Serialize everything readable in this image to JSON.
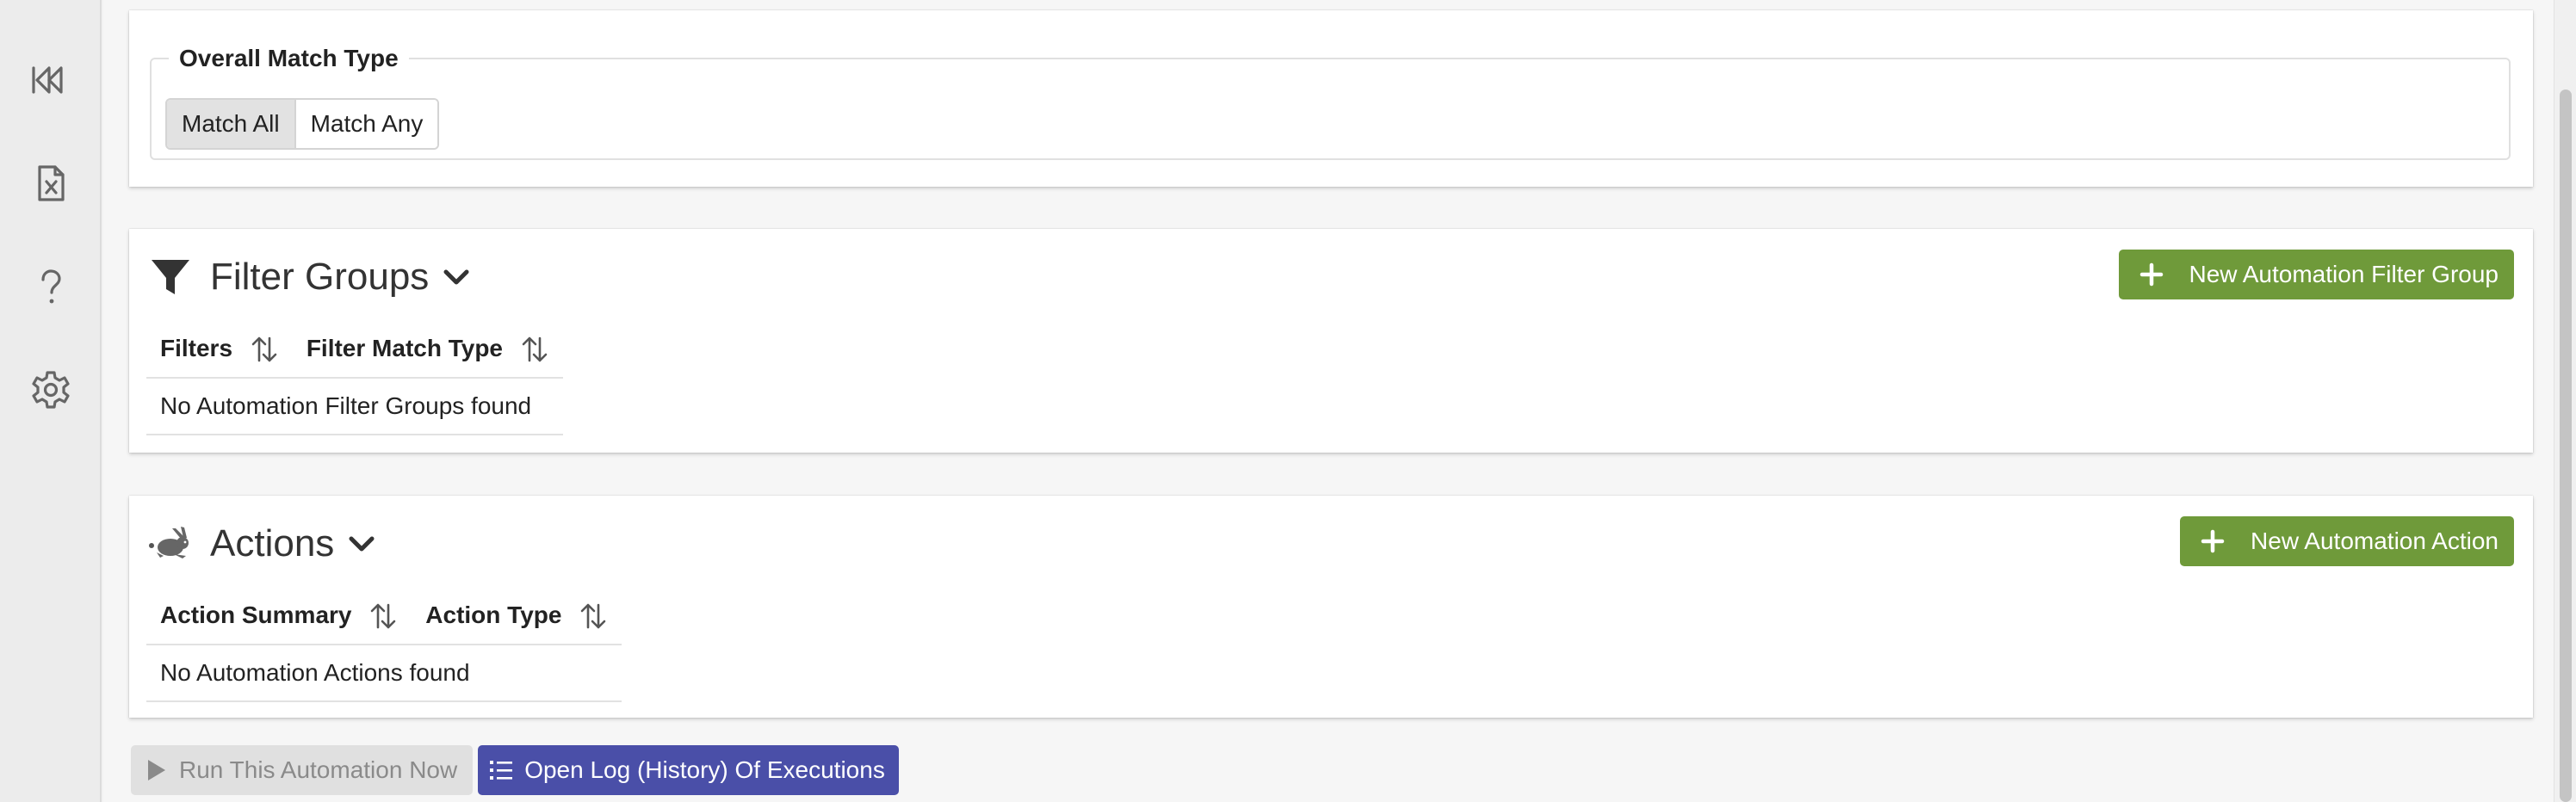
{
  "sidebar": {
    "items": [
      {
        "icon": "collapse-rewind-icon"
      },
      {
        "icon": "excel-file-icon"
      },
      {
        "icon": "help-question-icon"
      },
      {
        "icon": "gear-icon"
      }
    ]
  },
  "match_type": {
    "legend": "Overall Match Type",
    "options": [
      "Match All",
      "Match Any"
    ],
    "selected": "Match All"
  },
  "filter_groups": {
    "title": "Filter Groups",
    "icon": "filter-funnel-icon",
    "new_button": "New Automation Filter Group",
    "columns": [
      "Filters",
      "Filter Match Type"
    ],
    "empty_message": "No Automation Filter Groups found"
  },
  "actions": {
    "title": "Actions",
    "icon": "rabbit-icon",
    "new_button": "New Automation Action",
    "columns": [
      "Action Summary",
      "Action Type"
    ],
    "empty_message": "No Automation Actions found"
  },
  "footer": {
    "run_button": "Run This Automation Now",
    "log_button": "Open Log (History) Of Executions"
  },
  "colors": {
    "success": "#6f9a3a",
    "primary": "#4a4fa8",
    "disabled_bg": "#e0e0e0"
  }
}
